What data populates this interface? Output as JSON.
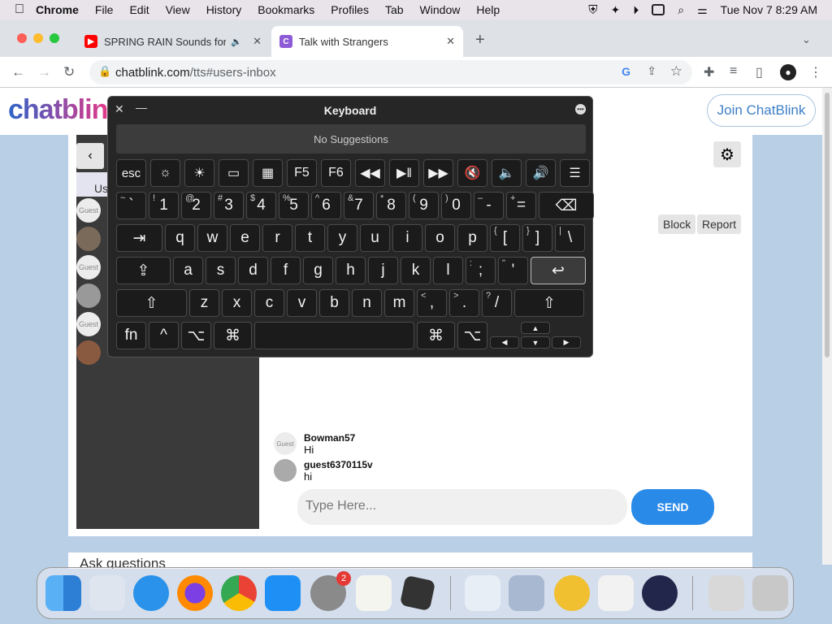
{
  "menubar": {
    "apple": "",
    "app": "Chrome",
    "items": [
      "File",
      "Edit",
      "View",
      "History",
      "Bookmarks",
      "Profiles",
      "Tab",
      "Window",
      "Help"
    ],
    "clock": "Tue Nov 7  8:29 AM"
  },
  "tabs": [
    {
      "title": "SPRING RAIN Sounds for S",
      "favicon_color": "#ff0000",
      "favicon_glyph": "▶"
    },
    {
      "title": "Talk with Strangers",
      "favicon_color": "#8e5bd6",
      "favicon_glyph": "C"
    }
  ],
  "address": {
    "domain": "chatblink.com",
    "path": "/tts#users-inbox"
  },
  "page": {
    "logo": "chatblin",
    "join_label": "Join ChatBlink",
    "sidebar_header": "Us",
    "avatar_guest": "Guest",
    "block_label": "Block",
    "report_label": "Report",
    "messages": [
      {
        "user": "Bowman57",
        "text": "Hi"
      },
      {
        "user": "guest6370115v",
        "text": "hi"
      }
    ],
    "input_placeholder": "Type Here...",
    "send_label": "SEND",
    "ask_label": "Ask questions"
  },
  "keyboard": {
    "title": "Keyboard",
    "suggestions": "No Suggestions",
    "fkeys": [
      "esc",
      "☼",
      "☀",
      "▭",
      "▦",
      "F5",
      "F6",
      "◀◀",
      "▶‖",
      "▶▶",
      "🔇",
      "🔈",
      "🔊",
      "☰"
    ],
    "row1": [
      [
        "~",
        "`"
      ],
      [
        "!",
        "1"
      ],
      [
        "@",
        "2"
      ],
      [
        "#",
        "3"
      ],
      [
        "$",
        "4"
      ],
      [
        "%",
        "5"
      ],
      [
        "^",
        "6"
      ],
      [
        "&",
        "7"
      ],
      [
        "*",
        "8"
      ],
      [
        "(",
        "9"
      ],
      [
        ")",
        "0"
      ],
      [
        "–",
        "-"
      ],
      [
        "+",
        "="
      ]
    ],
    "delete": "⌫",
    "tab": "⇥",
    "row2": [
      "q",
      "w",
      "e",
      "r",
      "t",
      "y",
      "u",
      "i",
      "o",
      "p"
    ],
    "row2b": [
      [
        "{",
        "["
      ],
      [
        "}",
        "]"
      ],
      [
        "|",
        "\\"
      ]
    ],
    "caps": "⇪",
    "row3": [
      "a",
      "s",
      "d",
      "f",
      "g",
      "h",
      "j",
      "k",
      "l"
    ],
    "row3b": [
      [
        ":",
        ";"
      ],
      [
        "\"",
        "'"
      ]
    ],
    "return": "↩",
    "shift": "⇧",
    "row4": [
      "z",
      "x",
      "c",
      "v",
      "b",
      "n",
      "m"
    ],
    "row4b": [
      [
        "<",
        ","
      ],
      [
        ">",
        "."
      ],
      [
        "?",
        "/"
      ]
    ],
    "fn": "fn",
    "ctrl": "^",
    "opt": "⌥",
    "cmd": "⌘",
    "arrows": {
      "up": "▲",
      "left": "◀",
      "down": "▼",
      "right": "▶"
    }
  },
  "dock": {
    "settings_badge": "2"
  }
}
